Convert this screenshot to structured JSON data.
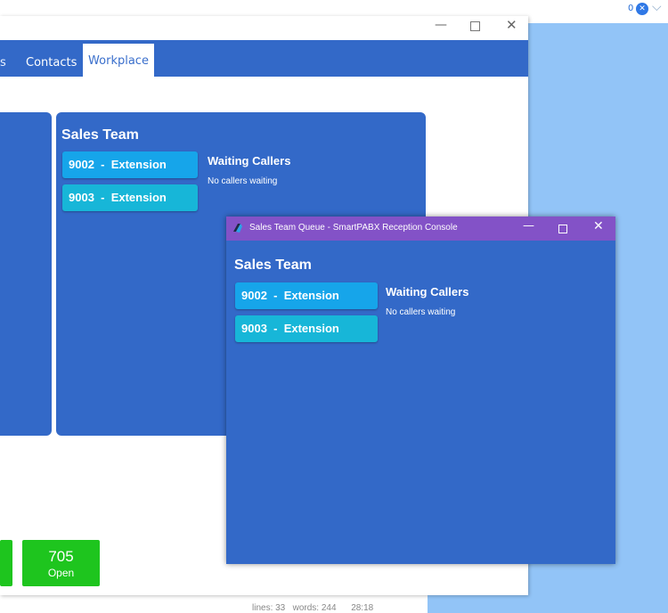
{
  "tray": {
    "badge": "0",
    "close_glyph": "✕",
    "chevron": "⌵"
  },
  "main_window": {
    "controls": {
      "minimize": "—",
      "close": "✕"
    },
    "tabs": [
      {
        "label": "s",
        "active": false
      },
      {
        "label": "Contacts",
        "active": false
      },
      {
        "label": "Workplace",
        "active": true
      }
    ],
    "queue": {
      "title": "Sales Team",
      "extensions": [
        {
          "number": "9002",
          "sep": "  -  ",
          "type": "Extension"
        },
        {
          "number": "9003",
          "sep": "  -  ",
          "type": "Extension"
        }
      ],
      "waiting_title": "Waiting Callers",
      "waiting_status": "No callers waiting"
    },
    "tiles": [
      {
        "value": "705",
        "label": "Open"
      }
    ]
  },
  "status_bar": {
    "lines": "lines: 33",
    "words": "words: 244",
    "time": "28:18"
  },
  "popup": {
    "title": "Sales Team Queue - SmartPABX Reception Console",
    "controls": {
      "minimize": "—",
      "close": "✕"
    },
    "queue": {
      "title": "Sales Team",
      "extensions": [
        {
          "number": "9002",
          "sep": "  -  ",
          "type": "Extension"
        },
        {
          "number": "9003",
          "sep": "  -  ",
          "type": "Extension"
        }
      ],
      "waiting_title": "Waiting Callers",
      "waiting_status": "No callers waiting"
    }
  },
  "colors": {
    "panel_blue": "#3369c8",
    "extension_primary": "#16a5ea",
    "extension_secondary": "#17b6d8",
    "tile_green": "#1ec51e",
    "popup_titlebar": "#8352c7",
    "desktop": "#92c4f7"
  }
}
